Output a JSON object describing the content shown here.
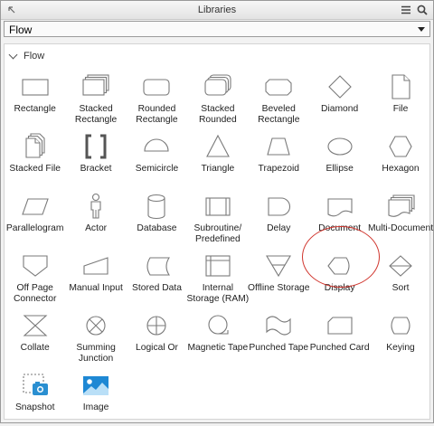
{
  "titlebar": {
    "title": "Libraries"
  },
  "dropdown": {
    "value": "Flow"
  },
  "section": {
    "title": "Flow"
  },
  "shapes": [
    {
      "name": "rectangle",
      "l1": "Rectangle",
      "l2": ""
    },
    {
      "name": "stacked-rectangle",
      "l1": "Stacked",
      "l2": "Rectangle"
    },
    {
      "name": "rounded-rectangle",
      "l1": "Rounded",
      "l2": "Rectangle"
    },
    {
      "name": "stacked-rounded",
      "l1": "Stacked",
      "l2": "Rounded"
    },
    {
      "name": "beveled-rectangle",
      "l1": "Beveled",
      "l2": "Rectangle"
    },
    {
      "name": "diamond",
      "l1": "Diamond",
      "l2": ""
    },
    {
      "name": "file",
      "l1": "File",
      "l2": ""
    },
    {
      "name": "stacked-file",
      "l1": "Stacked File",
      "l2": ""
    },
    {
      "name": "bracket",
      "l1": "Bracket",
      "l2": ""
    },
    {
      "name": "semicircle",
      "l1": "Semicircle",
      "l2": ""
    },
    {
      "name": "triangle",
      "l1": "Triangle",
      "l2": ""
    },
    {
      "name": "trapezoid",
      "l1": "Trapezoid",
      "l2": ""
    },
    {
      "name": "ellipse",
      "l1": "Ellipse",
      "l2": ""
    },
    {
      "name": "hexagon",
      "l1": "Hexagon",
      "l2": ""
    },
    {
      "name": "parallelogram",
      "l1": "Parallelogram",
      "l2": ""
    },
    {
      "name": "actor",
      "l1": "Actor",
      "l2": ""
    },
    {
      "name": "database",
      "l1": "Database",
      "l2": ""
    },
    {
      "name": "subroutine",
      "l1": "Subroutine/",
      "l2": "Predefined"
    },
    {
      "name": "delay",
      "l1": "Delay",
      "l2": ""
    },
    {
      "name": "document",
      "l1": "Document",
      "l2": ""
    },
    {
      "name": "multi-document",
      "l1": "Multi-Document",
      "l2": ""
    },
    {
      "name": "off-page-connector",
      "l1": "Off Page",
      "l2": "Connector"
    },
    {
      "name": "manual-input",
      "l1": "Manual Input",
      "l2": ""
    },
    {
      "name": "stored-data",
      "l1": "Stored Data",
      "l2": ""
    },
    {
      "name": "internal-storage",
      "l1": "Internal",
      "l2": "Storage (RAM)"
    },
    {
      "name": "offline-storage",
      "l1": "Offline Storage",
      "l2": ""
    },
    {
      "name": "display",
      "l1": "Display",
      "l2": ""
    },
    {
      "name": "sort",
      "l1": "Sort",
      "l2": ""
    },
    {
      "name": "collate",
      "l1": "Collate",
      "l2": ""
    },
    {
      "name": "summing-junction",
      "l1": "Summing",
      "l2": "Junction"
    },
    {
      "name": "logical-or",
      "l1": "Logical Or",
      "l2": ""
    },
    {
      "name": "magnetic-tape",
      "l1": "Magnetic Tape",
      "l2": ""
    },
    {
      "name": "punched-tape",
      "l1": "Punched Tape",
      "l2": ""
    },
    {
      "name": "punched-card",
      "l1": "Punched Card",
      "l2": ""
    },
    {
      "name": "keying",
      "l1": "Keying",
      "l2": ""
    },
    {
      "name": "snapshot",
      "l1": "Snapshot",
      "l2": ""
    },
    {
      "name": "image",
      "l1": "Image",
      "l2": ""
    }
  ]
}
